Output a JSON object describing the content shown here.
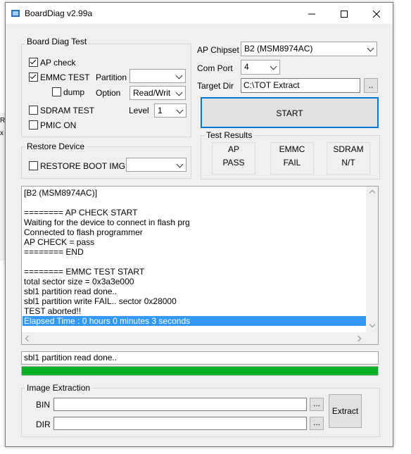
{
  "window": {
    "title": "BoardDiag v2.99a"
  },
  "board_diag": {
    "title": "Board Diag Test",
    "ap_check": {
      "label": "AP check",
      "checked": true
    },
    "emmc_test": {
      "label": "EMMC TEST",
      "checked": true
    },
    "dump": {
      "label": "dump",
      "checked": false
    },
    "partition": {
      "label": "Partition",
      "value": ""
    },
    "option": {
      "label": "Option",
      "value": "Read/Writ"
    },
    "sdram_test": {
      "label": "SDRAM TEST",
      "checked": false
    },
    "level": {
      "label": "Level",
      "value": "1"
    },
    "pmic_on": {
      "label": "PMIC ON",
      "checked": false
    }
  },
  "restore": {
    "title": "Restore Device",
    "restore_boot_img": {
      "label": "RESTORE BOOT IMG",
      "checked": false
    },
    "value": ""
  },
  "settings": {
    "chipset_label": "AP Chipset",
    "chipset_value": "B2 (MSM8974AC)",
    "com_port_label": "Com Port",
    "com_port_value": "4",
    "target_dir_label": "Target Dir",
    "target_dir_value": "C:\\TOT Extract",
    "browse_label": ".."
  },
  "start_label": "START",
  "results": {
    "title": "Test Results",
    "items": [
      {
        "name": "AP",
        "value": "PASS"
      },
      {
        "name": "EMMC",
        "value": "FAIL"
      },
      {
        "name": "SDRAM",
        "value": "N/T"
      }
    ]
  },
  "log": {
    "lines": [
      "[B2 (MSM8974AC)]",
      "",
      "======== AP CHECK START",
      "Waiting for the device to connect in flash prg",
      "Connected to flash programmer",
      "AP CHECK = pass",
      "======== END",
      "",
      "======== EMMC TEST START",
      "total sector size = 0x3a3e000",
      "sbl1 partition read done..",
      "sbl1 partition write FAIL.. sector 0x28000",
      "TEST aborted!!",
      "Elapsed Time : 0 hours 0 minutes 3 seconds"
    ],
    "selected_index": 13
  },
  "status": {
    "text": "sbl1 partition read done.."
  },
  "progress": {
    "percent": 100,
    "color": "#06b025"
  },
  "extraction": {
    "title": "Image Extraction",
    "bin_label": "BIN",
    "bin_value": "",
    "dir_label": "DIR",
    "dir_value": "",
    "browse_label": "...",
    "extract_label": "Extract"
  },
  "background_left_marks": [
    "R",
    "x"
  ]
}
